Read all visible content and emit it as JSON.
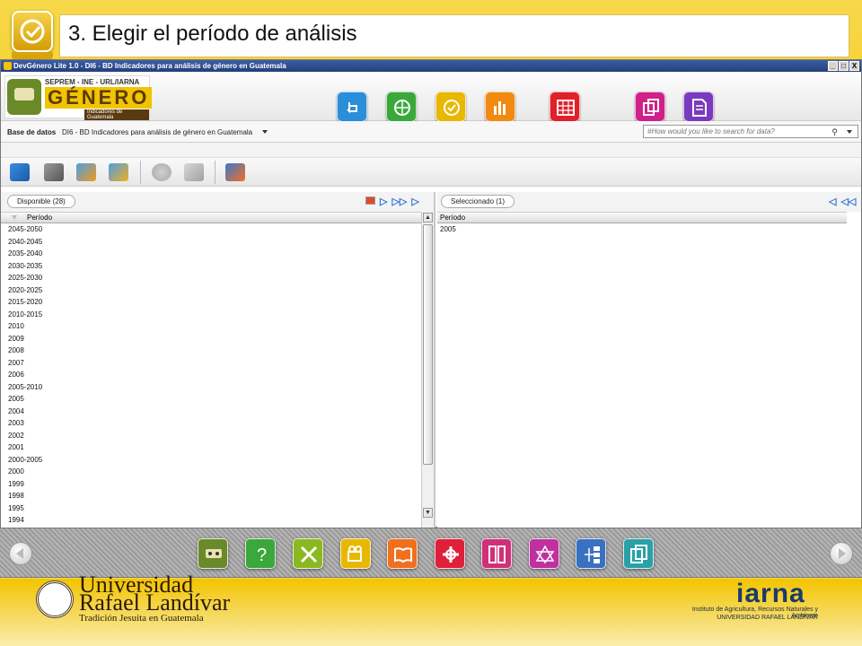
{
  "slide": {
    "title": "3. Elegir el período de análisis",
    "check_badge": "checkmark-icon"
  },
  "app": {
    "window_title": "DevGénero Lite 1.0 - DI6 - BD Indicadores para análisis de género en Guatemala",
    "window_buttons": [
      "_",
      "□",
      "X"
    ],
    "logo": {
      "top_text": "SEPREM - INE - URL/IARNA",
      "main_text": "GÉNERO",
      "sub_text": "Indicadores de Guatemala"
    },
    "header_icons": [
      {
        "name": "touch-icon",
        "color": "#2a8fd8"
      },
      {
        "name": "globe-icon",
        "color": "#3aa83a"
      },
      {
        "name": "checkmark-icon",
        "color": "#e8b800"
      },
      {
        "name": "bar-chart-icon",
        "color": "#f08a10"
      },
      {
        "name": "table-grid-icon",
        "color": "#e0202a"
      },
      {
        "name": "copy-icon",
        "color": "#d0208a"
      },
      {
        "name": "document-icon",
        "color": "#7a3ac0"
      }
    ],
    "database": {
      "label": "Base de datos",
      "value": "DI6 - BD Indicadores para análisis de género en Guatemala"
    },
    "search": {
      "placeholder": "#How would you like to search for data?"
    },
    "toolbar_icons": [
      "open-folder-icon",
      "print-icon",
      "database-export-icon",
      "database-edit-icon",
      "info-icon",
      "clipboard-icon",
      "refresh-icon"
    ],
    "left_pane": {
      "tab_label": "Disponible (28)",
      "column_header": "Período",
      "rows": [
        "2045-2050",
        "2040-2045",
        "2035-2040",
        "2030-2035",
        "2025-2030",
        "2020-2025",
        "2015-2020",
        "2010-2015",
        "2010",
        "2009",
        "2008",
        "2007",
        "2006",
        "2005-2010",
        "2005",
        "2004",
        "2003",
        "2002",
        "2001",
        "2000-2005",
        "2000",
        "1999",
        "1998",
        "1995",
        "1994"
      ]
    },
    "right_pane": {
      "tab_label": "Seleccionado (1)",
      "column_header": "Período",
      "rows": [
        "2005"
      ]
    }
  },
  "bottom_bar": {
    "icons": [
      {
        "name": "logo-face-icon",
        "color": "#6a8a2a"
      },
      {
        "name": "help-question-icon",
        "color": "#3aa83a"
      },
      {
        "name": "tools-icon",
        "color": "#8ab820"
      },
      {
        "name": "video-camera-icon",
        "color": "#e8b800"
      },
      {
        "name": "book-icon",
        "color": "#f07020"
      },
      {
        "name": "network-icon",
        "color": "#e0203a"
      },
      {
        "name": "columns-icon",
        "color": "#d0307a"
      },
      {
        "name": "star-network-icon",
        "color": "#c030a0"
      },
      {
        "name": "hierarchy-icon",
        "color": "#3a70c0"
      },
      {
        "name": "pages-icon",
        "color": "#2aa0a8"
      }
    ]
  },
  "footer": {
    "university_line1": "Universidad",
    "university_line2": "Rafael Landívar",
    "university_tagline": "Tradición Jesuita en Guatemala",
    "iarna": "iarna",
    "iarna_line1": "Instituto de Agricultura, Recursos Naturales y Ambiente",
    "iarna_line2": "UNIVERSIDAD RAFAEL LANDÍVAR"
  }
}
